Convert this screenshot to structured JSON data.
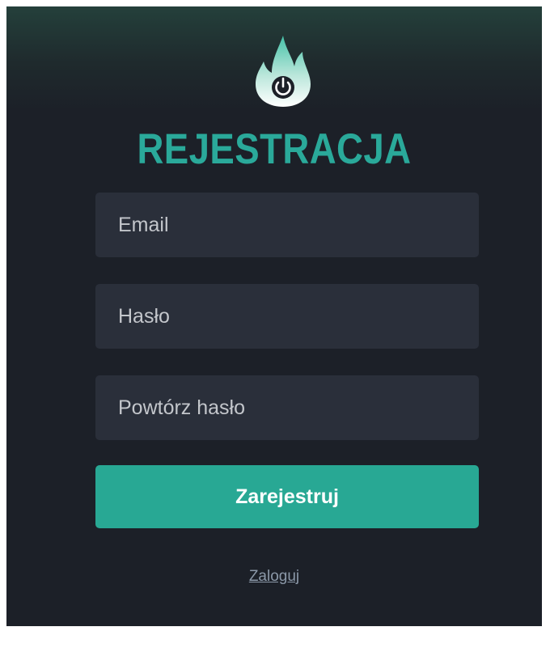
{
  "form": {
    "title": "REJESTRACJA",
    "email_placeholder": "Email",
    "password_placeholder": "Hasło",
    "repeat_password_placeholder": "Powtórz hasło",
    "submit_label": "Zarejestruj",
    "login_link_label": "Zaloguj"
  },
  "logo": {
    "icon": "flame-power-icon"
  },
  "colors": {
    "accent": "#2aa99a",
    "button": "#28a894",
    "panel_background": "#1c2028",
    "input_background": "#2a2f3a",
    "link": "#8b98a8"
  }
}
